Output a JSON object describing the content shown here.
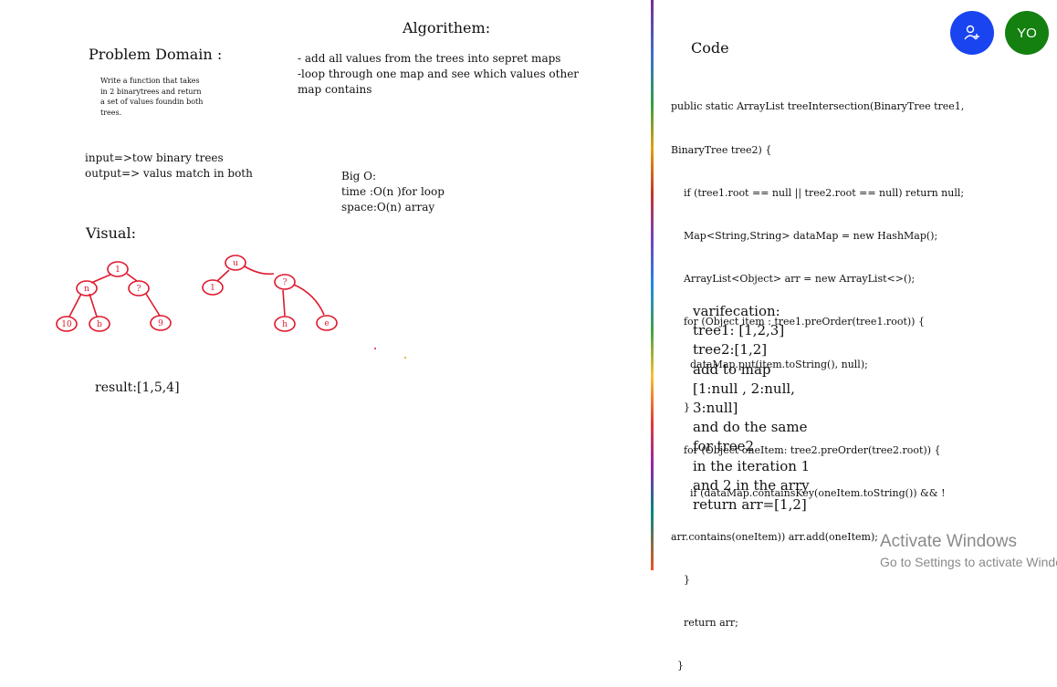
{
  "problem_domain": {
    "heading": "Problem Domain :",
    "description": [
      "Write a function that takes",
      "in 2 binarytrees and return",
      "a set of values foundin both",
      "trees."
    ],
    "io": [
      "input=>tow binary trees",
      "output=> valus match in both"
    ]
  },
  "algorithm": {
    "heading": "Algorithem:",
    "steps": [
      "- add all values from the trees into sepret maps",
      "-loop through one map and see which values other",
      "map contains"
    ]
  },
  "big_o": {
    "heading": "Big O:",
    "time": "time :O(n )for loop",
    "space": "space:O(n) array"
  },
  "visual": {
    "heading": "Visual:",
    "tree1": {
      "root": "1",
      "level1": [
        "n",
        "?"
      ],
      "level2": [
        "10",
        "b",
        "9"
      ]
    },
    "tree2": {
      "root": "u",
      "level1": [
        "1",
        "?"
      ],
      "level2": [
        "h",
        "e"
      ]
    },
    "result": "result:[1,5,4]"
  },
  "code": {
    "heading": "Code",
    "lines": [
      "public static ArrayList treeIntersection(BinaryTree tree1,",
      "BinaryTree tree2) {",
      "    if (tree1.root == null || tree2.root == null) return null;",
      "    Map<String,String> dataMap = new HashMap();",
      "    ArrayList<Object> arr = new ArrayList<>();",
      "    for (Object item : tree1.preOrder(tree1.root)) {",
      "      dataMap.put(item.toString(), null);",
      "    }",
      "    for (Object oneItem: tree2.preOrder(tree2.root)) {",
      "      if (dataMap.containsKey(oneItem.toString()) && !",
      "arr.contains(oneItem)) arr.add(oneItem);",
      "    }",
      "    return arr;",
      "  }"
    ]
  },
  "verification": {
    "lines": [
      "varifecation:",
      "tree1: [1,2,3]",
      "tree2:[1,2]",
      "add to map",
      "[1:null , 2:null,",
      "3:null]",
      "and do the same",
      "for tree2",
      "in the iteration 1",
      "and 2 in the arry",
      "return arr=[1,2]"
    ]
  },
  "toolbar": {
    "add_user_icon": "add-user-icon",
    "avatar_initials": "YO",
    "add_user_color": "#1a44f0",
    "avatar_color": "#13800f"
  },
  "watermark": {
    "title": "Activate Windows",
    "subtitle": "Go to Settings to activate Windows."
  },
  "colors": {
    "ink": "#111111",
    "tree_red": "#e0182d"
  }
}
